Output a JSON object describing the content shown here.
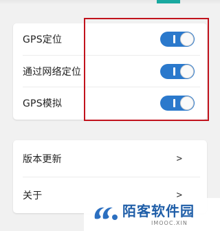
{
  "settings": {
    "toggles": [
      {
        "label": "GPS定位",
        "state": "on"
      },
      {
        "label": "通过网络定位",
        "state": "on"
      },
      {
        "label": "GPS模拟",
        "state": "on"
      }
    ],
    "links": [
      {
        "label": "版本更新",
        "chevron": ">"
      },
      {
        "label": "关于",
        "chevron": ">"
      }
    ]
  },
  "colors": {
    "toggle_on": "#2b79cc",
    "highlight": "#c1121c",
    "accent": "#19a9a0"
  },
  "watermark": {
    "title": "陌客软件园",
    "subtitle": "IMOOC.XIN"
  }
}
